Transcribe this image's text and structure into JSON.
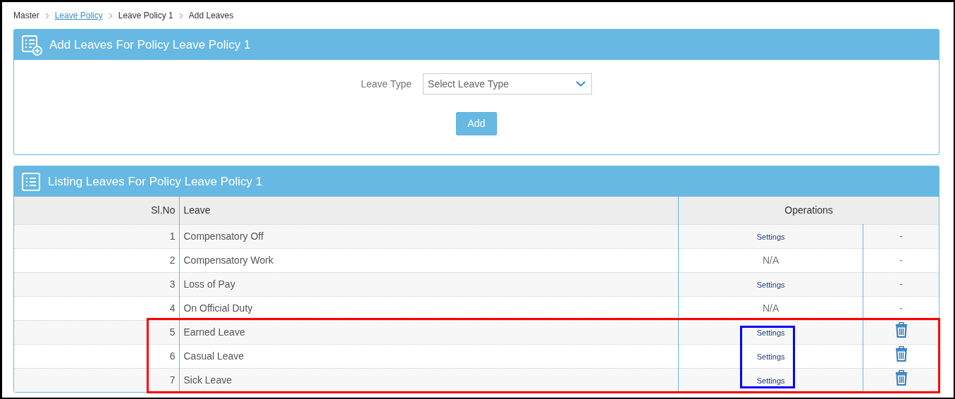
{
  "breadcrumb": [
    {
      "text": "Master",
      "link": false
    },
    {
      "text": "Leave Policy",
      "link": true
    },
    {
      "text": "Leave Policy 1",
      "link": false
    },
    {
      "text": "Add Leaves",
      "link": false
    }
  ],
  "add_panel": {
    "title": "Add Leaves For Policy Leave Policy 1",
    "field_label": "Leave Type",
    "select": {
      "placeholder": "Select Leave Type"
    },
    "button": "Add"
  },
  "list_panel": {
    "title": "Listing Leaves For Policy Leave Policy 1",
    "columns": [
      "Sl.No",
      "Leave",
      "Operations"
    ],
    "rows": [
      {
        "sl": "1",
        "leave": "Compensatory Off",
        "op1": {
          "kind": "link",
          "text": "Settings"
        },
        "op2": {
          "kind": "text",
          "text": "-"
        },
        "marked": false
      },
      {
        "sl": "2",
        "leave": "Compensatory Work",
        "op1": {
          "kind": "text",
          "text": "N/A"
        },
        "op2": {
          "kind": "text",
          "text": "-"
        },
        "marked": false
      },
      {
        "sl": "3",
        "leave": "Loss of Pay",
        "op1": {
          "kind": "link",
          "text": "Settings"
        },
        "op2": {
          "kind": "text",
          "text": "-"
        },
        "marked": false
      },
      {
        "sl": "4",
        "leave": "On Official Duty",
        "op1": {
          "kind": "text",
          "text": "N/A"
        },
        "op2": {
          "kind": "text",
          "text": "-"
        },
        "marked": false
      },
      {
        "sl": "5",
        "leave": "Earned Leave",
        "op1": {
          "kind": "link",
          "text": "Settings"
        },
        "op2": {
          "kind": "delete"
        },
        "marked": true
      },
      {
        "sl": "6",
        "leave": "Casual Leave",
        "op1": {
          "kind": "link",
          "text": "Settings"
        },
        "op2": {
          "kind": "delete"
        },
        "marked": true
      },
      {
        "sl": "7",
        "leave": "Sick Leave",
        "op1": {
          "kind": "link",
          "text": "Settings"
        },
        "op2": {
          "kind": "delete"
        },
        "marked": true
      }
    ]
  },
  "annotations": [
    {
      "kind": "rows",
      "color": "#ff0000"
    },
    {
      "kind": "settings",
      "color": "#0000ff"
    }
  ]
}
